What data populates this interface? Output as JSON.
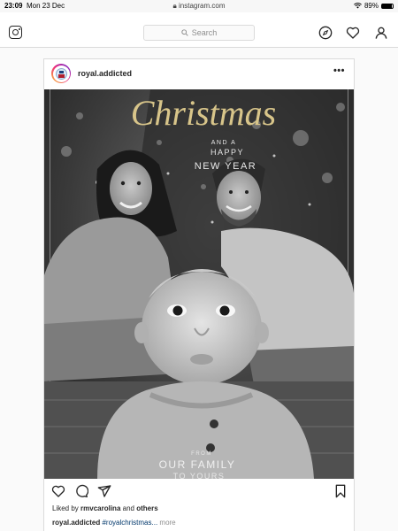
{
  "status_bar": {
    "time": "23:09",
    "date": "Mon 23 Dec",
    "url": "instagram.com",
    "battery": "89%",
    "battery_level": 0.89
  },
  "header": {
    "search_placeholder": "Search",
    "icons": [
      "instagram-logo-icon",
      "search-icon",
      "compass-icon",
      "heart-icon",
      "profile-icon"
    ]
  },
  "post": {
    "username": "royal.addicted",
    "more_label": "•••",
    "image_text": {
      "title": "Christmas",
      "and_a": "AND A",
      "happy": "HAPPY",
      "new_year": "NEW YEAR",
      "from": "FROM",
      "our_family": "OUR FAMILY",
      "to_yours": "TO YOURS"
    },
    "action_icons": [
      "heart-icon",
      "comment-icon",
      "share-icon",
      "bookmark-icon"
    ],
    "likes": {
      "prefix": "Liked by",
      "user": "rmvcarolina",
      "and": "and",
      "others": "others"
    },
    "caption": {
      "username": "royal.addicted",
      "text": "#royalchristmas...",
      "more": "more"
    }
  },
  "colors": {
    "ig_border": "#dbdbdb",
    "text_primary": "#262626",
    "text_secondary": "#8e8e8e",
    "hashtag": "#00376b",
    "gold_script": "#d8c58a"
  }
}
